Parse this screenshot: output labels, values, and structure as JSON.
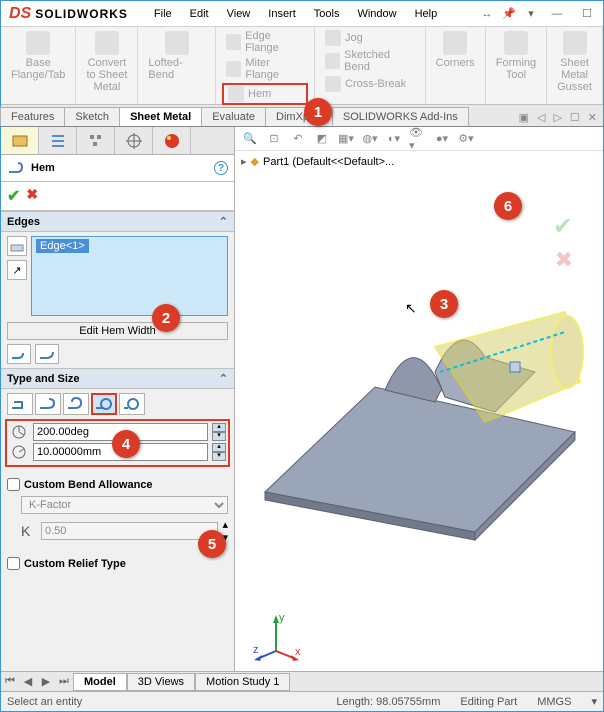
{
  "app": {
    "name": "SOLIDWORKS"
  },
  "menu": [
    "File",
    "Edit",
    "View",
    "Insert",
    "Tools",
    "Window",
    "Help"
  ],
  "ribbon": {
    "base": "Base\nFlange/Tab",
    "convert": "Convert\nto Sheet\nMetal",
    "lofted": "Lofted-Bend",
    "edgeflange": "Edge Flange",
    "miter": "Miter Flange",
    "hem": "Hem",
    "jog": "Jog",
    "sketched": "Sketched Bend",
    "cross": "Cross-Break",
    "corners": "Corners",
    "forming": "Forming\nTool",
    "gusset": "Sheet\nMetal\nGusset"
  },
  "tabs": [
    "Features",
    "Sketch",
    "Sheet Metal",
    "Evaluate",
    "DimXpert",
    "SOLIDWORKS Add-Ins"
  ],
  "activeTab": "Sheet Metal",
  "feature": {
    "title": "Hem"
  },
  "edgesPanel": {
    "title": "Edges",
    "item": "Edge<1>",
    "editBtn": "Edit Hem Width"
  },
  "typePanel": {
    "title": "Type and Size",
    "angle": "200.00deg",
    "radius": "10.00000mm"
  },
  "cba": {
    "title": "Custom Bend Allowance",
    "method": "K-Factor",
    "k": "0.50"
  },
  "crt": {
    "title": "Custom Relief Type"
  },
  "tree": {
    "part": "Part1  (Default<<Default>..."
  },
  "bottomTabs": [
    "Model",
    "3D Views",
    "Motion Study 1"
  ],
  "status": {
    "prompt": "Select an entity",
    "length": "Length: 98.05755mm",
    "mode": "Editing Part",
    "units": "MMGS"
  },
  "callouts": {
    "c1": "1",
    "c2": "2",
    "c3": "3",
    "c4": "4",
    "c5": "5",
    "c6": "6"
  }
}
